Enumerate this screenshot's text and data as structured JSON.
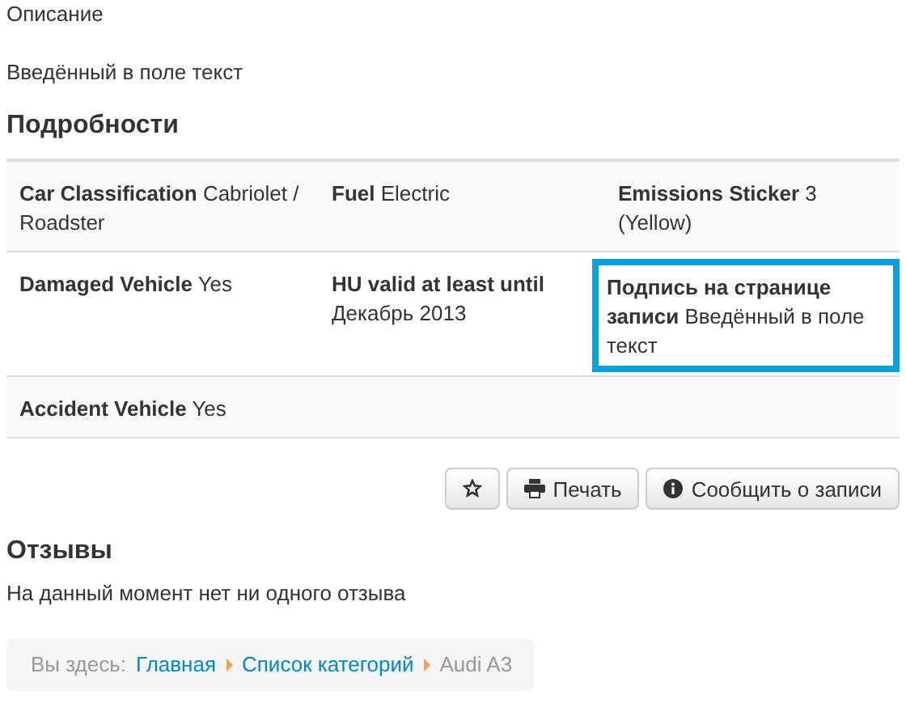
{
  "description": {
    "label": "Описание",
    "value": "Введённый в поле текст"
  },
  "details": {
    "heading": "Подробности",
    "rows": [
      [
        {
          "label": "Car Classification",
          "value": "Cabriolet / Roadster",
          "highlighted": false
        },
        {
          "label": "Fuel",
          "value": "Electric",
          "highlighted": false
        },
        {
          "label": "Emissions Sticker",
          "value": "3 (Yellow)",
          "highlighted": false
        }
      ],
      [
        {
          "label": "Damaged Vehicle",
          "value": "Yes",
          "highlighted": false
        },
        {
          "label": "HU valid at least until",
          "value": "Декабрь 2013",
          "highlighted": false
        },
        {
          "label": "Подпись на странице записи",
          "value": "Введённый в поле текст",
          "highlighted": true
        }
      ],
      [
        {
          "label": "Accident Vehicle",
          "value": "Yes",
          "highlighted": false
        }
      ]
    ]
  },
  "actions": [
    {
      "kind": "favorite"
    },
    {
      "kind": "print",
      "label": "Печать"
    },
    {
      "kind": "report",
      "label": "Сообщить о записи"
    }
  ],
  "reviews": {
    "heading": "Отзывы",
    "empty_text": "На данный момент нет ни одного отзыва"
  },
  "breadcrumb": {
    "prefix": "Вы здесь:",
    "links": [
      "Главная",
      "Список категорий"
    ],
    "current": "Audi A3"
  }
}
